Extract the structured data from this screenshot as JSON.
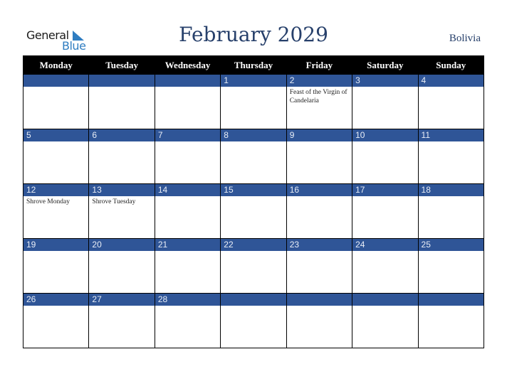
{
  "logo": {
    "general": "General",
    "blue": "Blue"
  },
  "title": "February 2029",
  "country": "Bolivia",
  "colors": {
    "header_bg": "#000000",
    "date_band": "#2f5597",
    "title": "#27406b",
    "logo_blue": "#2f7dc1"
  },
  "weekdays": [
    "Monday",
    "Tuesday",
    "Wednesday",
    "Thursday",
    "Friday",
    "Saturday",
    "Sunday"
  ],
  "weeks": [
    [
      {
        "day": "",
        "event": ""
      },
      {
        "day": "",
        "event": ""
      },
      {
        "day": "",
        "event": ""
      },
      {
        "day": "1",
        "event": ""
      },
      {
        "day": "2",
        "event": "Feast of the Virgin of Candelaria"
      },
      {
        "day": "3",
        "event": ""
      },
      {
        "day": "4",
        "event": ""
      }
    ],
    [
      {
        "day": "5",
        "event": ""
      },
      {
        "day": "6",
        "event": ""
      },
      {
        "day": "7",
        "event": ""
      },
      {
        "day": "8",
        "event": ""
      },
      {
        "day": "9",
        "event": ""
      },
      {
        "day": "10",
        "event": ""
      },
      {
        "day": "11",
        "event": ""
      }
    ],
    [
      {
        "day": "12",
        "event": "Shrove Monday"
      },
      {
        "day": "13",
        "event": "Shrove Tuesday"
      },
      {
        "day": "14",
        "event": ""
      },
      {
        "day": "15",
        "event": ""
      },
      {
        "day": "16",
        "event": ""
      },
      {
        "day": "17",
        "event": ""
      },
      {
        "day": "18",
        "event": ""
      }
    ],
    [
      {
        "day": "19",
        "event": ""
      },
      {
        "day": "20",
        "event": ""
      },
      {
        "day": "21",
        "event": ""
      },
      {
        "day": "22",
        "event": ""
      },
      {
        "day": "23",
        "event": ""
      },
      {
        "day": "24",
        "event": ""
      },
      {
        "day": "25",
        "event": ""
      }
    ],
    [
      {
        "day": "26",
        "event": ""
      },
      {
        "day": "27",
        "event": ""
      },
      {
        "day": "28",
        "event": ""
      },
      {
        "day": "",
        "event": ""
      },
      {
        "day": "",
        "event": ""
      },
      {
        "day": "",
        "event": ""
      },
      {
        "day": "",
        "event": ""
      }
    ]
  ]
}
